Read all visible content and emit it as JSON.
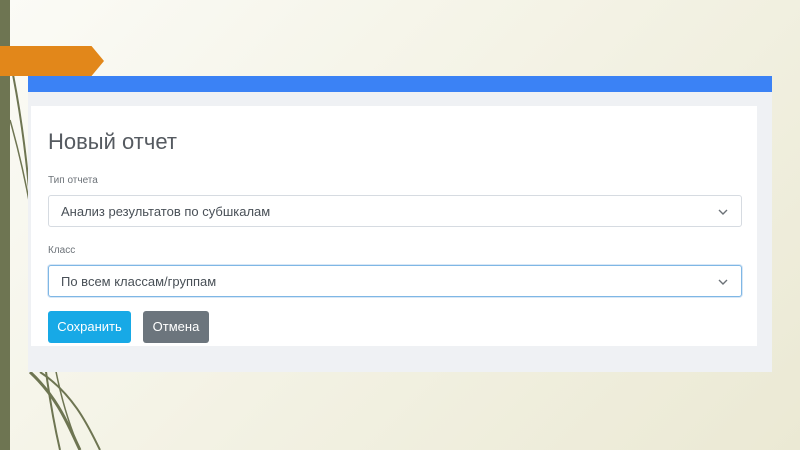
{
  "colors": {
    "accent_bar": "#3b82f5",
    "orange_tab": "#e2871a",
    "save_button": "#17a9e6",
    "cancel_button": "#6c757d"
  },
  "form": {
    "title": "Новый отчет",
    "report_type": {
      "label": "Тип отчета",
      "value": "Анализ результатов по субшкалам",
      "icon": "chevron-down-icon"
    },
    "class": {
      "label": "Класс",
      "value": "По всем классам/группам",
      "icon": "chevron-down-icon"
    },
    "buttons": {
      "save": "Сохранить",
      "cancel": "Отмена"
    }
  }
}
